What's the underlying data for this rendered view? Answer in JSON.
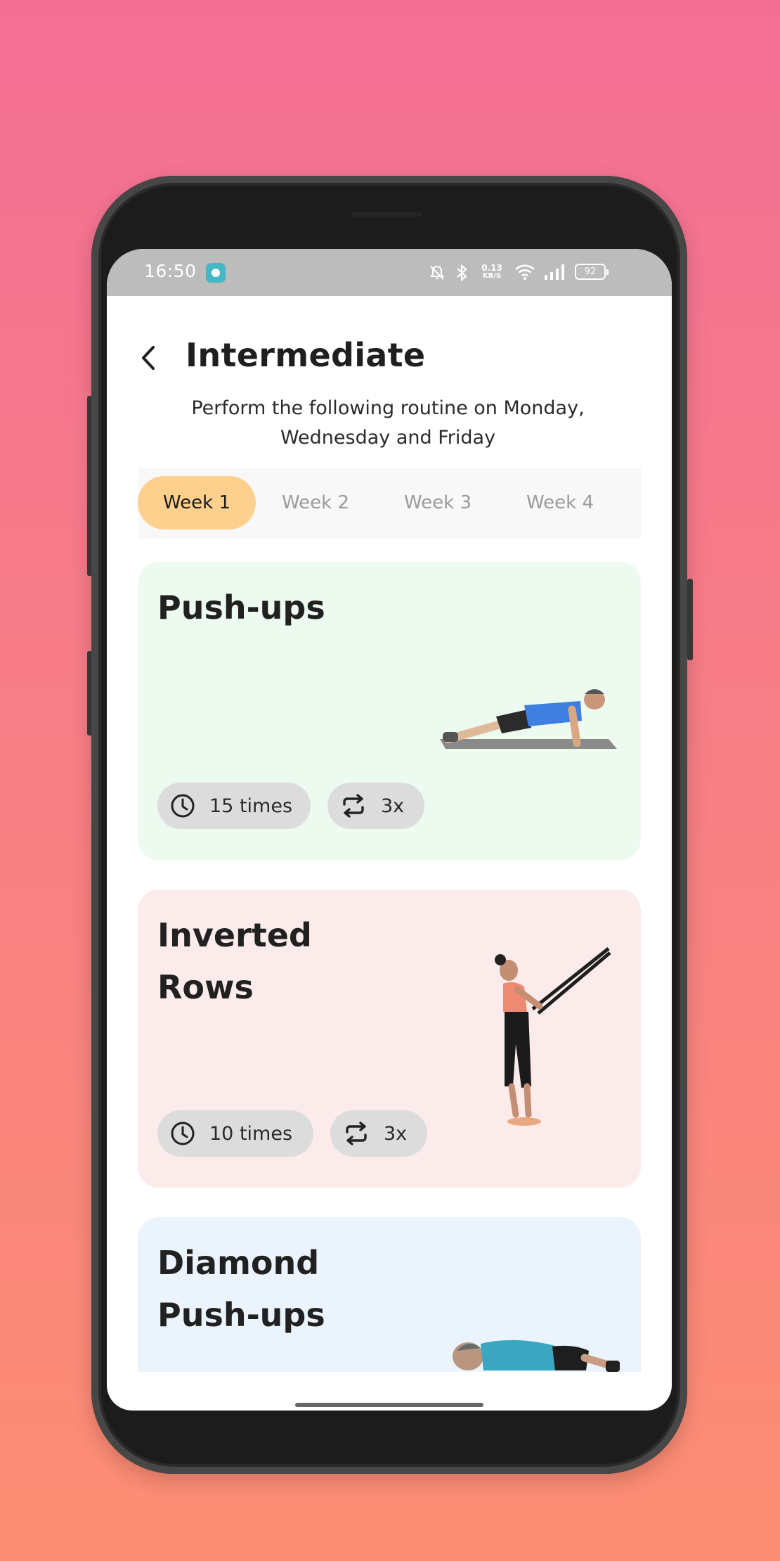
{
  "status_bar": {
    "time": "16:50",
    "network_speed_value": "0.13",
    "network_speed_unit": "KB/S",
    "battery": "92"
  },
  "header": {
    "title": "Intermediate",
    "subtitle": "Perform the following routine on Monday, Wednesday and Friday"
  },
  "tabs": [
    {
      "label": "Week 1",
      "active": true
    },
    {
      "label": "Week 2",
      "active": false
    },
    {
      "label": "Week 3",
      "active": false
    },
    {
      "label": "Week 4",
      "active": false
    }
  ],
  "exercises": [
    {
      "name": "Push-ups",
      "reps": "15 times",
      "sets": "3x",
      "color": "#ecfaef"
    },
    {
      "name": "Inverted Rows",
      "reps": "10 times",
      "sets": "3x",
      "color": "#fcebeb"
    },
    {
      "name": "Diamond Push-ups",
      "color": "#ebf3fc"
    }
  ],
  "colors": {
    "accent_tab": "#fdd08d",
    "status_bar": "#bcbcbc",
    "chip": "#dcdcdc"
  },
  "icons": [
    "back-arrow-icon",
    "clock-icon",
    "repeat-icon",
    "bell-off-icon",
    "bluetooth-icon",
    "wifi-icon",
    "signal-icon",
    "battery-icon"
  ]
}
